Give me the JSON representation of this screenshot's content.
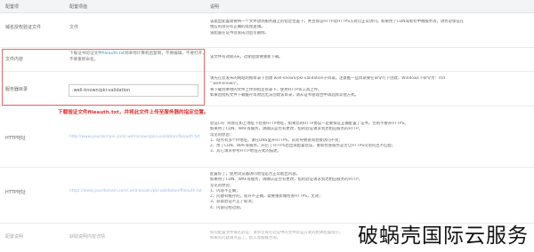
{
  "header": {
    "col1": "配置项",
    "col2": "配置项值",
    "col3": "说明"
  },
  "rows": [
    {
      "label": "域名授权验证文件",
      "value": "文件",
      "desc": [
        "该类型配置需要将一个文件放到服务器上的指定位置下，并且保证HTTP及HTTPS方式可正常访问。如果用了CDN或者有中端服务等，请务必保证在",
        "相应的部分有正确的处理逻辑。",
        "该配置在证书签发成功后可删除。"
      ]
    },
    {
      "label": "文件内容",
      "value_lines": [
        "下载证书验证文件fileauth.txt到本地计算机后复制，不要编辑，不要打开，",
        "不要重新命名。"
      ],
      "value_link": "fileauth.txt",
      "desc": [
        "该文件有效期3天，过期后需要重新下载。"
      ]
    },
    {
      "label": "服务器目录",
      "value": ".well-known/pki-validation",
      "desc": [
        "请先在您发布的网站的根目录下创建.well-known/pki-validation子目录。注意推一些目录要在命令行下创建，Windows下命令为：md",
        "\".well-known\"。",
        "将下载到本地的文件上传到指定目录下，使用HTTP等工具上传。",
        "如果因授权文件下载缓存等原因无法创建该目录，请从证书管理台中调选择其他方式。"
      ]
    },
    {
      "label": "HTTP地址",
      "value_url": "http://www.yourdomain.com/.well-known/pki-validation/fileauth.txt",
      "desc": [
        "验证CA厂商会在如上地址下检查HTTP地址，如果您的HTTP协议一定要保证正确配置了证书，否则不要开HTTPS。",
        "如果用了CDN、WAF等服务，请确认是否有更改，指的验证请求到达相应服务的HTTP。",
        "常见的原因：",
        "1、站点有多个IP地址，请在DNS里开HTTPS，从而导致查询直接访问不到；",
        "2、用了CDN、WAF等服务，开启了HTTPS后出现配置错误，重新检查服务是否让HTTPS可访问且不匹配；",
        "3、其它请求参考HTTP地址方式的描述。"
      ]
    },
    {
      "label": "HTTP地址",
      "value_url": "https://www.yourdomain.com/.well-known/pki-validation/fileauth.txt",
      "desc": [
        "配置好了，使用浏览器访问地址是否正常能出内容。",
        "如果用了CDN、WAF等服务，请确认是否有更改，指的验证请求到达相应服务的HTTP。",
        "常见的原因：",
        "1、内容不正确；",
        "2、问题有缓存的，或许不正确，需要重新做检查HTTPS，无效；",
        "3、获取验证不正了取消；",
        "4、内容已经过期。"
      ]
    },
    {
      "label": "配置说明",
      "value": "获取说明内容详情",
      "desc": [
        "如何配置文件域名验证：请参见域名验证中的文件验证方式的相关配置指引，",
        "如果有问题请点击了，加入客服群咨询。"
      ]
    }
  ],
  "annotation": "下载验证文件fileauth.txt，并将此文件上传至服务器的指定位置。",
  "watermark": "破蜗壳国际云服务",
  "colors": {
    "highlight_border": "#e46a6a",
    "annotation_text": "#e0302f",
    "link": "#3b8de0"
  }
}
